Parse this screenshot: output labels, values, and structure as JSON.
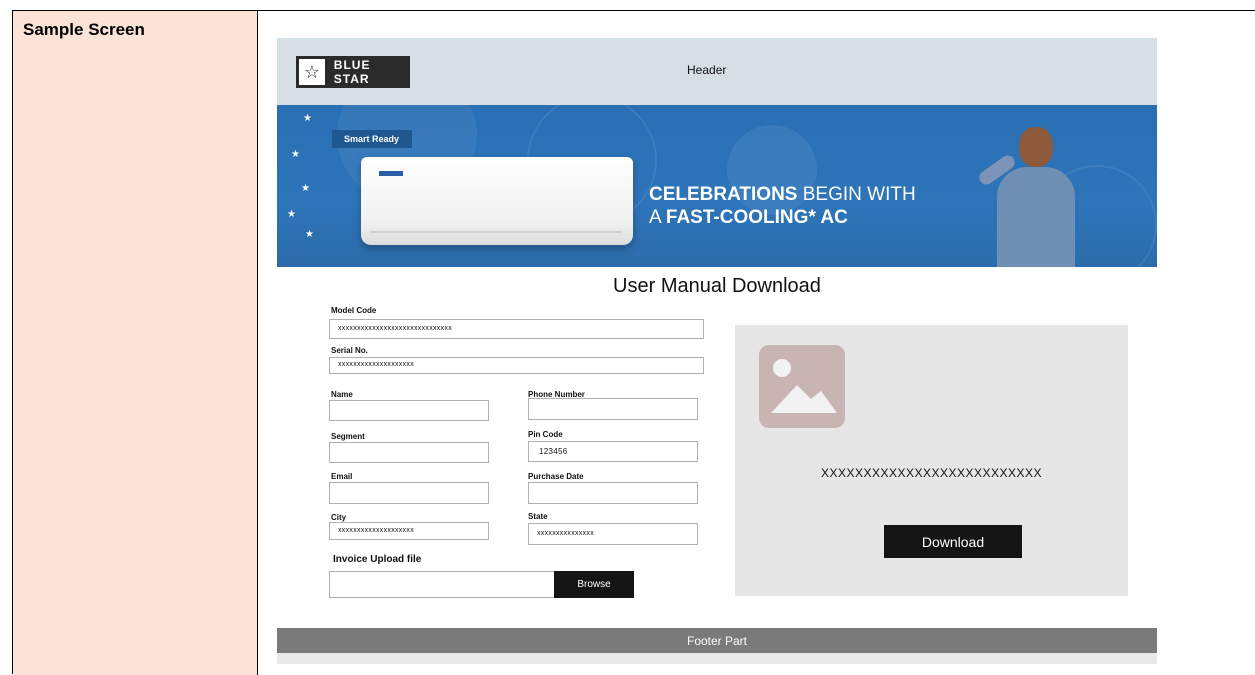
{
  "sample_label": "Sample Screen",
  "header": {
    "brand": "BLUE STAR",
    "title": "Header"
  },
  "banner": {
    "ribbon": "Smart Ready",
    "headline_bold_1": "CELEBRATIONS",
    "headline_rest_1": " BEGIN WITH",
    "headline_prefix_2": "A ",
    "headline_bold_2": "FAST-COOLING* AC"
  },
  "page_title": "User Manual Download",
  "form": {
    "model_code_label": "Model Code",
    "model_code_value": "xxxxxxxxxxxxxxxxxxxxxxxxxxxxxx",
    "serial_label": "Serial No.",
    "serial_value": "xxxxxxxxxxxxxxxxxxxx",
    "name_label": "Name",
    "name_value": "",
    "phone_label": "Phone Number",
    "phone_value": "",
    "segment_label": "Segment",
    "segment_value": "",
    "pincode_label": "Pin Code",
    "pincode_value": "123456",
    "email_label": "Email",
    "email_value": "",
    "purchase_label": "Purchase Date",
    "purchase_value": "",
    "city_label": "City",
    "city_value": "xxxxxxxxxxxxxxxxxxxx",
    "state_label": "State",
    "state_value": "xxxxxxxxxxxxxxx",
    "upload_label": "Invoice Upload file",
    "browse_label": "Browse"
  },
  "preview": {
    "code": "XXXXXXXXXXXXXXXXXXXXXXXXXX",
    "download_label": "Download"
  },
  "footer": {
    "text": "Footer Part"
  }
}
